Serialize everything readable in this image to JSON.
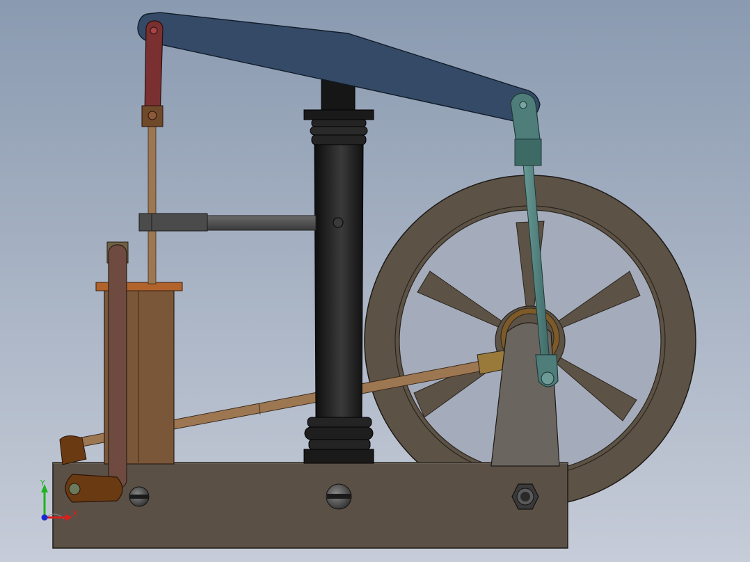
{
  "viewport": {
    "background_top": "#8a9ab0",
    "background_bottom": "#c6ccd8"
  },
  "triad": {
    "y_label": "Y",
    "x_label": "X",
    "y_color": "#1fb31f",
    "x_color": "#d62020",
    "z_color": "#1a2ad0"
  },
  "colors": {
    "beam": "#354a66",
    "column": "#1d1d1d",
    "flywheel": "#5c5245",
    "base": "#5b5045",
    "cylinder": "#7b573a",
    "cylinder_top": "#b0632a",
    "piston_link": "#7a3030",
    "connecting_rod": "#4e7d7a",
    "bearing_stand": "#6b655f",
    "valve_rod": "#6e4a40",
    "crank_arm": "#6a3a12",
    "rods": "#9d7752",
    "parallel_arm": "#4b4b4b"
  },
  "model_parts": [
    "beam",
    "column",
    "flywheel",
    "base-plate",
    "cylinder",
    "piston-link",
    "piston-rod",
    "parallel-arm",
    "connecting-rod",
    "bearing-stand",
    "eccentric-rod",
    "valve-rod",
    "crank-arm",
    "base-screws"
  ]
}
